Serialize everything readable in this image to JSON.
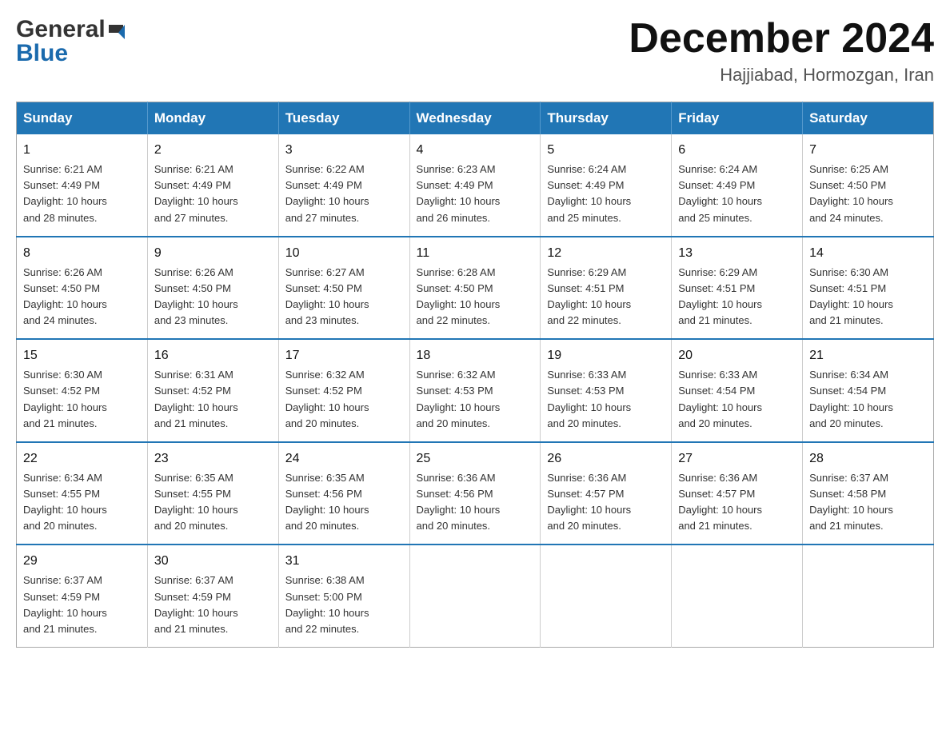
{
  "header": {
    "logo_general": "General",
    "logo_blue": "Blue",
    "title": "December 2024",
    "location": "Hajjiabad, Hormozgan, Iran"
  },
  "weekdays": [
    "Sunday",
    "Monday",
    "Tuesday",
    "Wednesday",
    "Thursday",
    "Friday",
    "Saturday"
  ],
  "weeks": [
    [
      {
        "day": "1",
        "sunrise": "6:21 AM",
        "sunset": "4:49 PM",
        "daylight": "10 hours and 28 minutes."
      },
      {
        "day": "2",
        "sunrise": "6:21 AM",
        "sunset": "4:49 PM",
        "daylight": "10 hours and 27 minutes."
      },
      {
        "day": "3",
        "sunrise": "6:22 AM",
        "sunset": "4:49 PM",
        "daylight": "10 hours and 27 minutes."
      },
      {
        "day": "4",
        "sunrise": "6:23 AM",
        "sunset": "4:49 PM",
        "daylight": "10 hours and 26 minutes."
      },
      {
        "day": "5",
        "sunrise": "6:24 AM",
        "sunset": "4:49 PM",
        "daylight": "10 hours and 25 minutes."
      },
      {
        "day": "6",
        "sunrise": "6:24 AM",
        "sunset": "4:49 PM",
        "daylight": "10 hours and 25 minutes."
      },
      {
        "day": "7",
        "sunrise": "6:25 AM",
        "sunset": "4:50 PM",
        "daylight": "10 hours and 24 minutes."
      }
    ],
    [
      {
        "day": "8",
        "sunrise": "6:26 AM",
        "sunset": "4:50 PM",
        "daylight": "10 hours and 24 minutes."
      },
      {
        "day": "9",
        "sunrise": "6:26 AM",
        "sunset": "4:50 PM",
        "daylight": "10 hours and 23 minutes."
      },
      {
        "day": "10",
        "sunrise": "6:27 AM",
        "sunset": "4:50 PM",
        "daylight": "10 hours and 23 minutes."
      },
      {
        "day": "11",
        "sunrise": "6:28 AM",
        "sunset": "4:50 PM",
        "daylight": "10 hours and 22 minutes."
      },
      {
        "day": "12",
        "sunrise": "6:29 AM",
        "sunset": "4:51 PM",
        "daylight": "10 hours and 22 minutes."
      },
      {
        "day": "13",
        "sunrise": "6:29 AM",
        "sunset": "4:51 PM",
        "daylight": "10 hours and 21 minutes."
      },
      {
        "day": "14",
        "sunrise": "6:30 AM",
        "sunset": "4:51 PM",
        "daylight": "10 hours and 21 minutes."
      }
    ],
    [
      {
        "day": "15",
        "sunrise": "6:30 AM",
        "sunset": "4:52 PM",
        "daylight": "10 hours and 21 minutes."
      },
      {
        "day": "16",
        "sunrise": "6:31 AM",
        "sunset": "4:52 PM",
        "daylight": "10 hours and 21 minutes."
      },
      {
        "day": "17",
        "sunrise": "6:32 AM",
        "sunset": "4:52 PM",
        "daylight": "10 hours and 20 minutes."
      },
      {
        "day": "18",
        "sunrise": "6:32 AM",
        "sunset": "4:53 PM",
        "daylight": "10 hours and 20 minutes."
      },
      {
        "day": "19",
        "sunrise": "6:33 AM",
        "sunset": "4:53 PM",
        "daylight": "10 hours and 20 minutes."
      },
      {
        "day": "20",
        "sunrise": "6:33 AM",
        "sunset": "4:54 PM",
        "daylight": "10 hours and 20 minutes."
      },
      {
        "day": "21",
        "sunrise": "6:34 AM",
        "sunset": "4:54 PM",
        "daylight": "10 hours and 20 minutes."
      }
    ],
    [
      {
        "day": "22",
        "sunrise": "6:34 AM",
        "sunset": "4:55 PM",
        "daylight": "10 hours and 20 minutes."
      },
      {
        "day": "23",
        "sunrise": "6:35 AM",
        "sunset": "4:55 PM",
        "daylight": "10 hours and 20 minutes."
      },
      {
        "day": "24",
        "sunrise": "6:35 AM",
        "sunset": "4:56 PM",
        "daylight": "10 hours and 20 minutes."
      },
      {
        "day": "25",
        "sunrise": "6:36 AM",
        "sunset": "4:56 PM",
        "daylight": "10 hours and 20 minutes."
      },
      {
        "day": "26",
        "sunrise": "6:36 AM",
        "sunset": "4:57 PM",
        "daylight": "10 hours and 20 minutes."
      },
      {
        "day": "27",
        "sunrise": "6:36 AM",
        "sunset": "4:57 PM",
        "daylight": "10 hours and 21 minutes."
      },
      {
        "day": "28",
        "sunrise": "6:37 AM",
        "sunset": "4:58 PM",
        "daylight": "10 hours and 21 minutes."
      }
    ],
    [
      {
        "day": "29",
        "sunrise": "6:37 AM",
        "sunset": "4:59 PM",
        "daylight": "10 hours and 21 minutes."
      },
      {
        "day": "30",
        "sunrise": "6:37 AM",
        "sunset": "4:59 PM",
        "daylight": "10 hours and 21 minutes."
      },
      {
        "day": "31",
        "sunrise": "6:38 AM",
        "sunset": "5:00 PM",
        "daylight": "10 hours and 22 minutes."
      },
      null,
      null,
      null,
      null
    ]
  ],
  "labels": {
    "sunrise": "Sunrise:",
    "sunset": "Sunset:",
    "daylight": "Daylight:"
  }
}
